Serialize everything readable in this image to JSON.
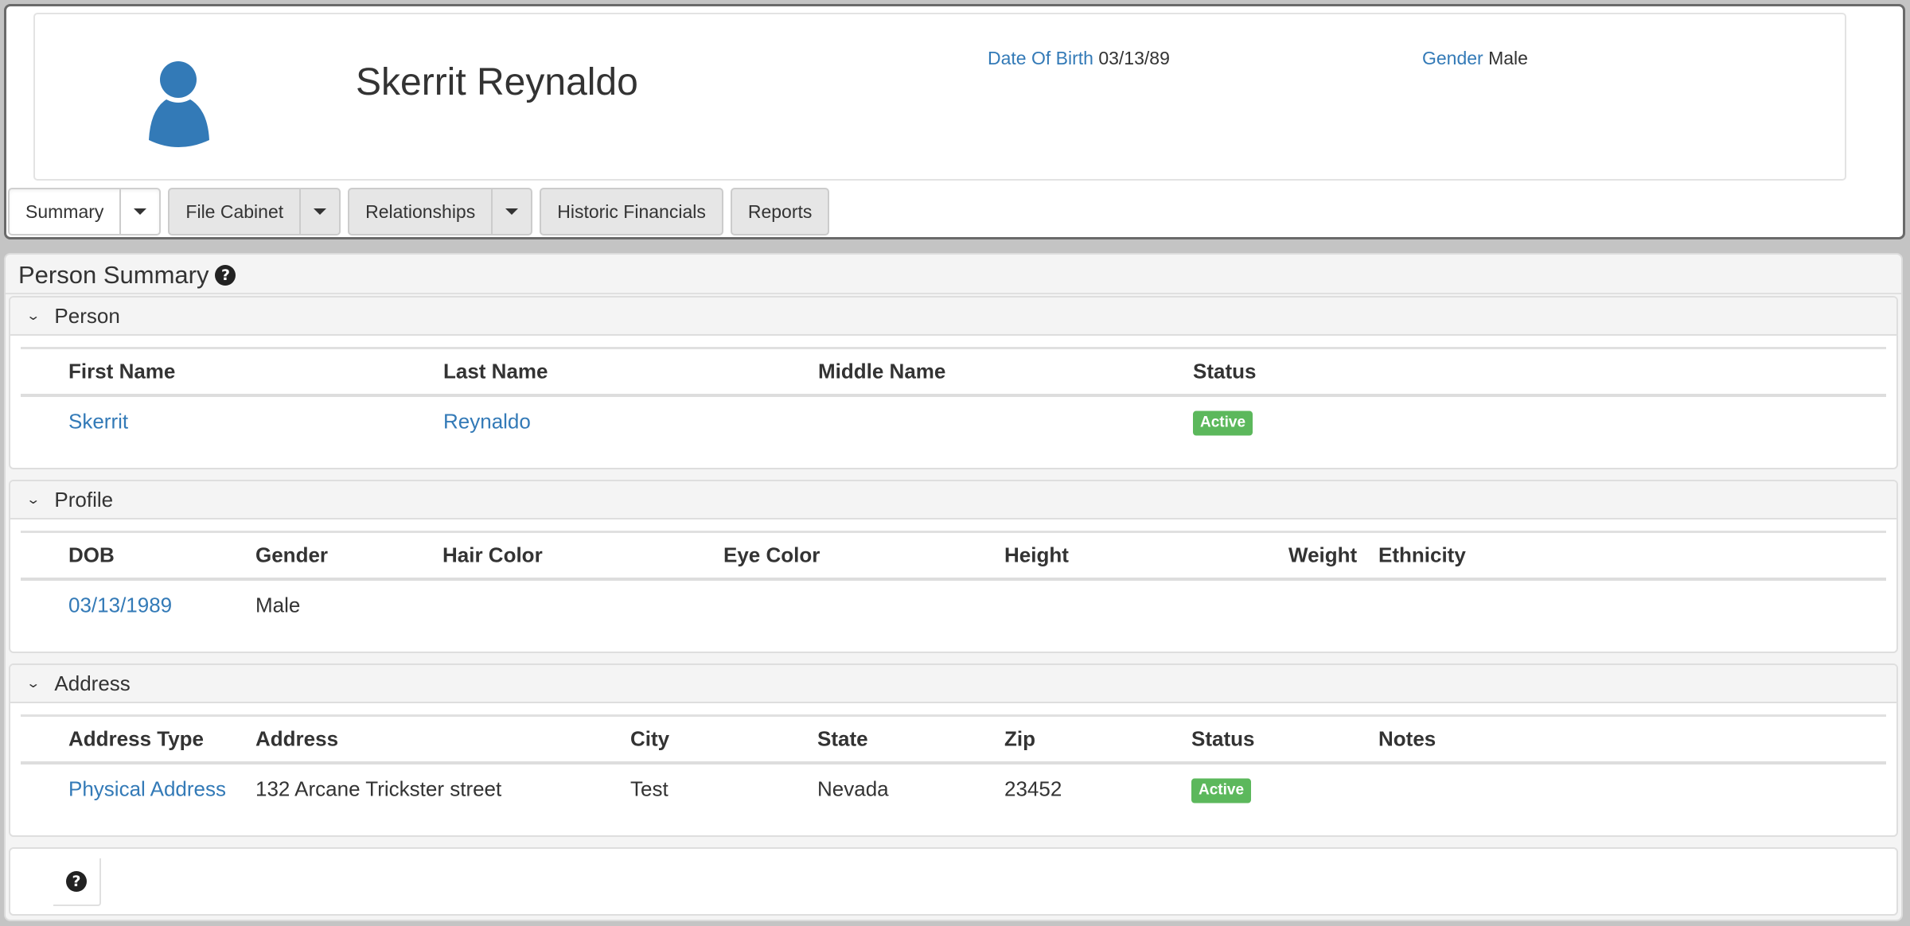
{
  "header": {
    "person_name": "Skerrit Reynaldo",
    "dob_label": "Date Of Birth",
    "dob_value": "03/13/89",
    "gender_label": "Gender",
    "gender_value": "Male",
    "avatar_icon": "user-icon",
    "accent_color": "#337ab7"
  },
  "tabs": [
    {
      "label": "Summary",
      "has_dropdown": true,
      "active": true
    },
    {
      "label": "File Cabinet",
      "has_dropdown": true,
      "active": false
    },
    {
      "label": "Relationships",
      "has_dropdown": true,
      "active": false
    },
    {
      "label": "Historic Financials",
      "has_dropdown": false,
      "active": false
    },
    {
      "label": "Reports",
      "has_dropdown": false,
      "active": false
    }
  ],
  "summary": {
    "title": "Person Summary",
    "help_icon": "?"
  },
  "sections": {
    "person": {
      "title": "Person",
      "columns": [
        "First Name",
        "Last Name",
        "Middle Name",
        "Status"
      ],
      "rows": [
        {
          "first_name": "Skerrit",
          "last_name": "Reynaldo",
          "middle_name": "",
          "status": "Active"
        }
      ]
    },
    "profile": {
      "title": "Profile",
      "columns": [
        "DOB",
        "Gender",
        "Hair Color",
        "Eye Color",
        "Height",
        "Weight",
        "Ethnicity"
      ],
      "rows": [
        {
          "dob": "03/13/1989",
          "gender": "Male",
          "hair_color": "",
          "eye_color": "",
          "height": "",
          "weight": "",
          "ethnicity": ""
        }
      ]
    },
    "address": {
      "title": "Address",
      "columns": [
        "Address Type",
        "Address",
        "City",
        "State",
        "Zip",
        "Status",
        "Notes"
      ],
      "rows": [
        {
          "address_type": "Physical Address",
          "address": "132 Arcane Trickster street",
          "city": "Test",
          "state": "Nevada",
          "zip": "23452",
          "status": "Active",
          "notes": ""
        }
      ]
    }
  },
  "footer": {
    "help_icon": "?"
  },
  "status_colors": {
    "active": "#5cb85c"
  }
}
